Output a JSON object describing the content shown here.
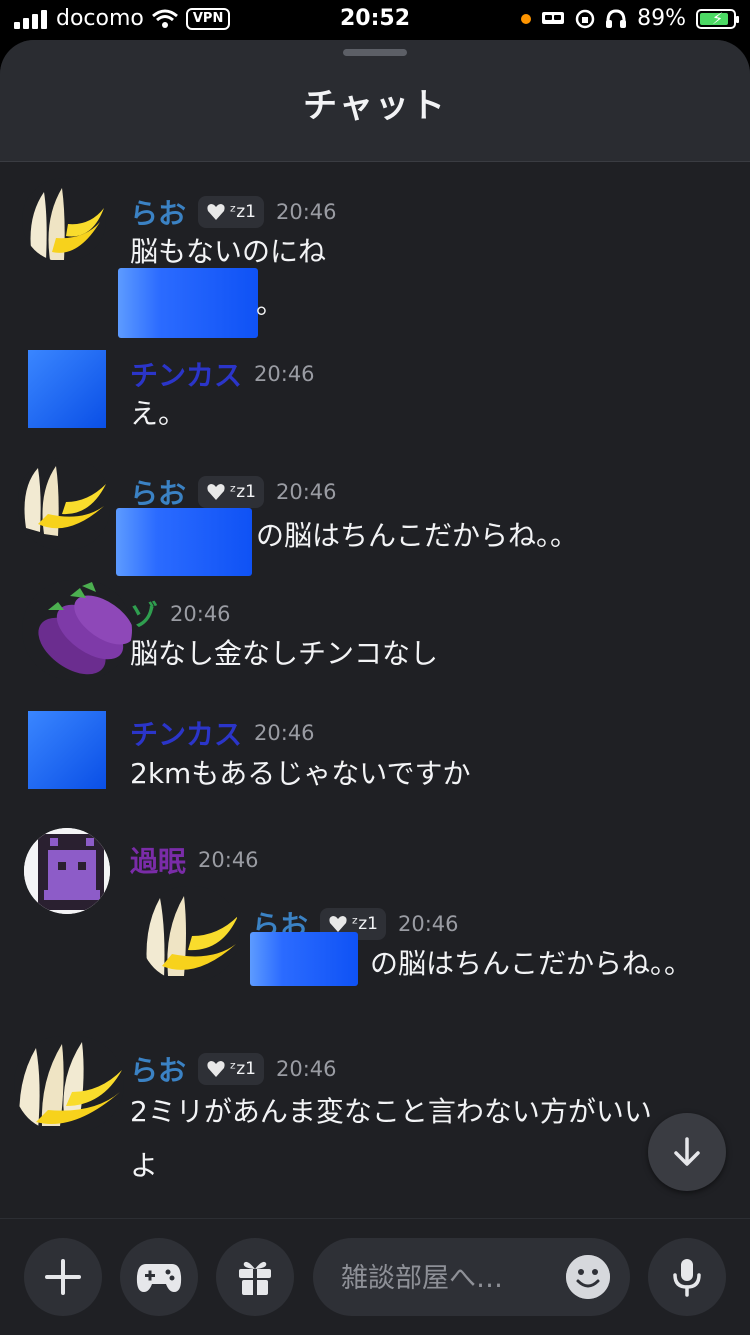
{
  "status_bar": {
    "carrier": "docomo",
    "vpn": "VPN",
    "time": "20:52",
    "battery": "89%",
    "battery_level": 0.89
  },
  "header": {
    "title": "チャット"
  },
  "colors": {
    "rao": "#3b82c4",
    "chinkasu": "#2b35c9",
    "zo": "#2f9e4f",
    "kamin": "#7a2ca8"
  },
  "messages": [
    {
      "name": "らお",
      "badge": "ᶻz1",
      "time": "20:46",
      "lines": [
        "脳もないのにね",
        "。"
      ]
    },
    {
      "name": "チンカス",
      "time": "20:46",
      "lines": [
        "え。"
      ]
    },
    {
      "name": "らお",
      "badge": "ᶻz1",
      "time": "20:46",
      "lines": [
        "の脳はちんこだからね。。"
      ]
    },
    {
      "name": "ゾ",
      "time": "20:46",
      "lines": [
        "脳なし金なしチンコなし"
      ]
    },
    {
      "name": "チンカス",
      "time": "20:46",
      "lines": [
        "2kmもあるじゃないですか"
      ]
    },
    {
      "name": "過眠",
      "time": "20:46",
      "reply": {
        "name": "らお",
        "badge": "ᶻz1",
        "time": "20:46",
        "text": "の脳はちんこだからね。。"
      }
    },
    {
      "name": "らお",
      "badge": "ᶻz1",
      "time": "20:46",
      "lines": [
        "2ミリがあんま変なこと言わない方がいい",
        "よ"
      ]
    }
  ],
  "input": {
    "placeholder": "雑談部屋へ…"
  },
  "icons": [
    "plus-icon",
    "gamepad-icon",
    "gift-icon",
    "emoji-icon",
    "mic-icon",
    "arrow-down-icon"
  ]
}
